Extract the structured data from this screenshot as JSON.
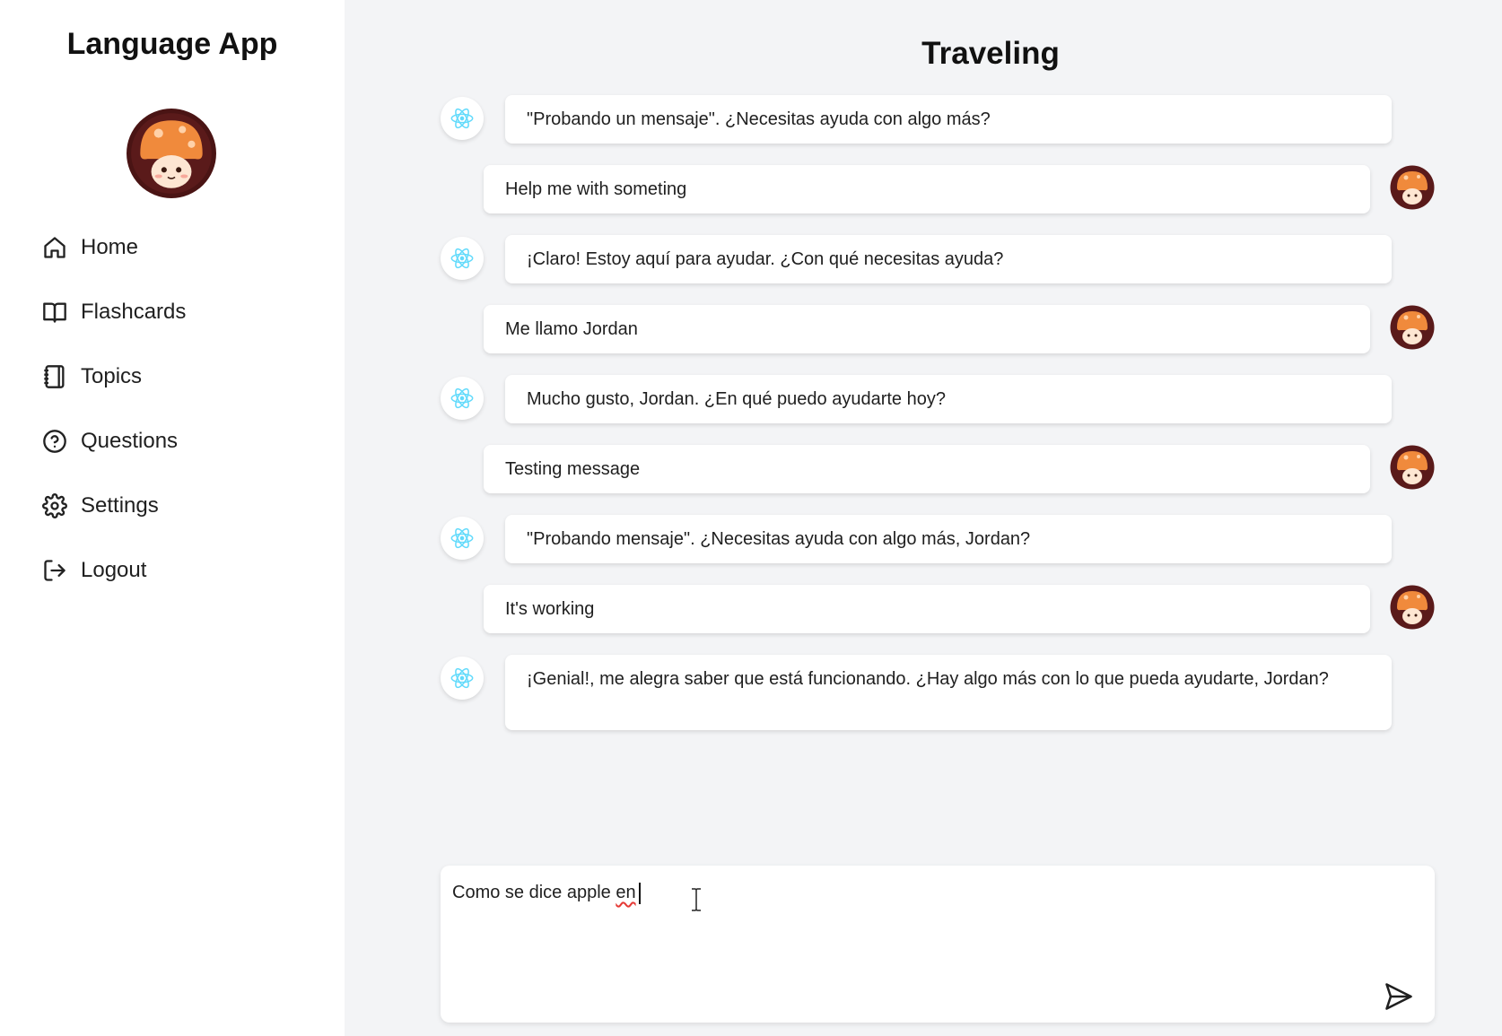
{
  "app": {
    "title": "Language App"
  },
  "sidebar": {
    "items": [
      {
        "label": "Home",
        "icon": "home-icon"
      },
      {
        "label": "Flashcards",
        "icon": "book-icon"
      },
      {
        "label": "Topics",
        "icon": "notebook-icon"
      },
      {
        "label": "Questions",
        "icon": "question-circle-icon"
      },
      {
        "label": "Settings",
        "icon": "gear-icon"
      },
      {
        "label": "Logout",
        "icon": "logout-icon"
      }
    ]
  },
  "chat": {
    "title": "Traveling",
    "messages": [
      {
        "role": "bot",
        "text": "\"Probando un mensaje\". ¿Necesitas ayuda con algo más?"
      },
      {
        "role": "user",
        "text": "Help me with someting"
      },
      {
        "role": "bot",
        "text": "¡Claro! Estoy aquí para ayudar. ¿Con qué necesitas ayuda?"
      },
      {
        "role": "user",
        "text": "Me llamo Jordan"
      },
      {
        "role": "bot",
        "text": "Mucho gusto, Jordan. ¿En qué puedo ayudarte hoy?"
      },
      {
        "role": "user",
        "text": "Testing message"
      },
      {
        "role": "bot",
        "text": "\"Probando mensaje\". ¿Necesitas ayuda con algo más, Jordan?"
      },
      {
        "role": "user",
        "text": "It's working"
      },
      {
        "role": "bot",
        "text": "¡Genial!, me alegra saber que está funcionando. ¿Hay algo más con lo que pueda ayudarte, Jordan?"
      }
    ]
  },
  "input": {
    "value_prefix": "Como se dice apple ",
    "value_misspelled": "en"
  },
  "colors": {
    "sidebar_bg": "#ffffff",
    "main_bg": "#f3f4f6",
    "bot_icon": "#61dafb",
    "mushroom_cap": "#f08a3c",
    "avatar_ring": "#5a1a1a"
  }
}
